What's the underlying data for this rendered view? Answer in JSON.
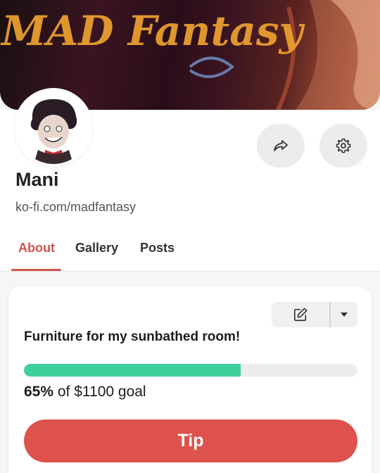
{
  "profile": {
    "name": "Mani",
    "url": "ko-fi.com/madfantasy",
    "banner_text": "MAD Fantasy"
  },
  "actions": {
    "share_icon": "share-arrow-icon",
    "settings_icon": "gear-icon"
  },
  "tabs": [
    {
      "label": "About",
      "active": true
    },
    {
      "label": "Gallery",
      "active": false
    },
    {
      "label": "Posts",
      "active": false
    }
  ],
  "goal": {
    "title": "Furniture for my sunbathed room!",
    "progress_percent": 65,
    "percent_label": "65%",
    "of_text": " of $1100 goal",
    "edit_icon": "edit-icon",
    "dropdown_icon": "caret-down-icon"
  },
  "tip": {
    "label": "Tip"
  },
  "colors": {
    "accent": "#dd524c",
    "tab_active": "#d2544c",
    "progress": "#3fcf9a"
  }
}
